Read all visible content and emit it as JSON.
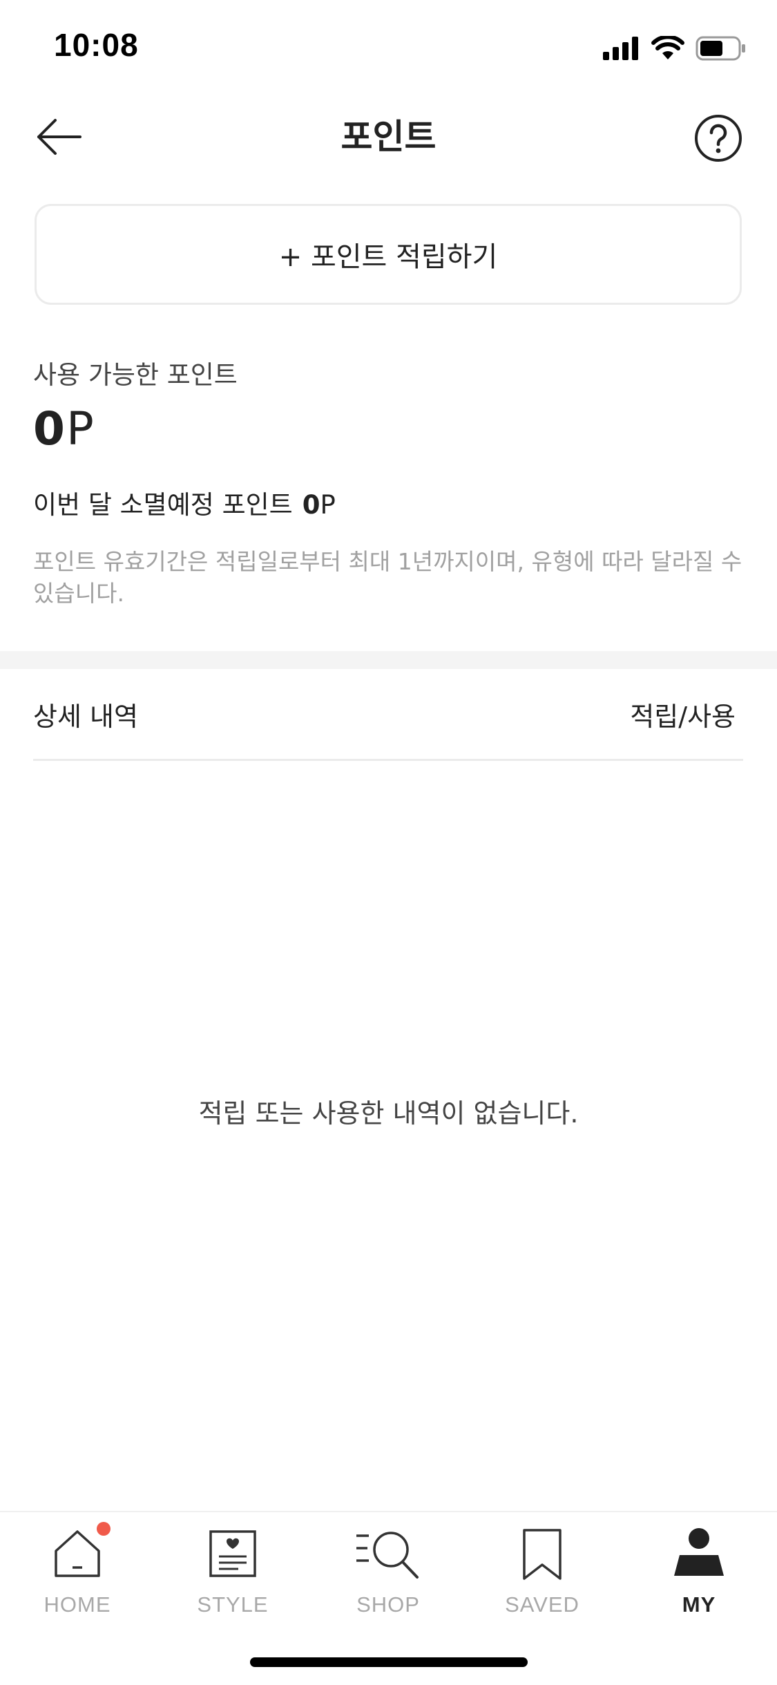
{
  "status_bar": {
    "time": "10:08",
    "icons": [
      "signal-icon",
      "wifi-icon",
      "battery-icon"
    ],
    "battery_level": 0.6
  },
  "header": {
    "title": "포인트",
    "back_icon": "arrow-left-icon",
    "help_icon": "question-circle-icon"
  },
  "earn_button": {
    "label": "+ 포인트 적립하기"
  },
  "available": {
    "label": "사용 가능한 포인트",
    "value": "0",
    "unit": "P"
  },
  "expiring": {
    "label": "이번 달 소멸예정 포인트",
    "value": "0",
    "unit": "P"
  },
  "notice": "포인트 유효기간은 적립일로부터 최대 1년까지이며, 유형에 따라 달라질 수 있습니다.",
  "details": {
    "title": "상세 내역",
    "filter": "적립/사용",
    "empty_message": "적립 또는 사용한 내역이 없습니다."
  },
  "bottom_nav": {
    "items": [
      {
        "label": "HOME",
        "icon": "home-icon",
        "active": false,
        "has_badge": true
      },
      {
        "label": "STYLE",
        "icon": "style-icon",
        "active": false
      },
      {
        "label": "SHOP",
        "icon": "shop-search-icon",
        "active": false
      },
      {
        "label": "SAVED",
        "icon": "bookmark-icon",
        "active": false
      },
      {
        "label": "MY",
        "icon": "profile-icon",
        "active": true
      }
    ]
  },
  "colors": {
    "text_primary": "#222222",
    "text_muted": "#a0a0a0",
    "border": "#ebebeb",
    "badge": "#f05a4a",
    "divider_bg": "#f4f4f4"
  }
}
